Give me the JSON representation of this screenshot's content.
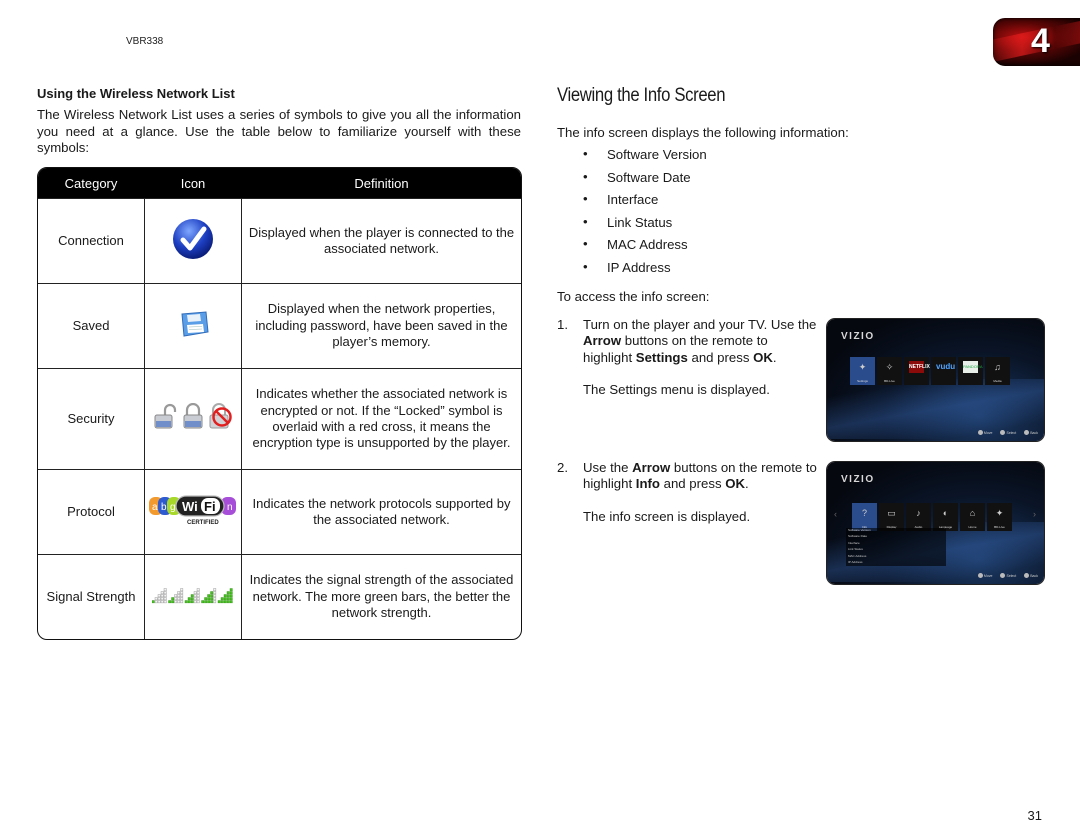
{
  "header": {
    "model": "VBR338",
    "chapter": "4"
  },
  "left": {
    "heading": "Using the Wireless Network List",
    "intro": "The Wireless Network List uses a series of symbols to give you all the information you need at a glance. Use the table below to familiarize yourself with these symbols:",
    "table": {
      "headers": [
        "Category",
        "Icon",
        "Definition"
      ],
      "rows": [
        {
          "category": "Connection",
          "icon": "checkmark-icon",
          "definition": "Displayed when the player is connected to the associated network."
        },
        {
          "category": "Saved",
          "icon": "floppy-disk-icon",
          "definition": "Displayed when the network properties, including password, have been saved in the player’s memory."
        },
        {
          "category": "Security",
          "icon": "padlock-icons",
          "definition": "Indicates whether the associated network is encrypted or not. If the “Locked” symbol is overlaid with a red cross, it means the encryption type is unsupported by the player."
        },
        {
          "category": "Protocol",
          "icon": "wifi-certified-icon",
          "definition": "Indicates the network protocols supported by the associated network."
        },
        {
          "category": "Signal Strength",
          "icon": "signal-bars-icon",
          "definition": "Indicates the signal strength of the associated network. The more green bars, the better the network strength."
        }
      ],
      "wifi_letters": [
        "a",
        "b",
        "g",
        "n"
      ],
      "wifi_text": "Wi Fi",
      "wifi_certified": "CERTIFIED",
      "signal_levels": [
        1,
        2,
        3,
        4,
        5
      ]
    }
  },
  "right": {
    "title": "Viewing the Info Screen",
    "intro": "The info screen displays the following information:",
    "bullets": [
      "Software Version",
      "Software Date",
      "Interface",
      "Link Status",
      "MAC Address",
      "IP Address"
    ],
    "access_label": "To access the info screen:",
    "steps": [
      {
        "num": "1.",
        "parts": [
          "Turn on the player and your TV. Use the ",
          "Arrow",
          " buttons on the remote to highlight ",
          "Settings",
          " and press ",
          "OK",
          "."
        ],
        "result": "The Settings menu is displayed."
      },
      {
        "num": "2.",
        "parts": [
          "Use the ",
          "Arrow",
          " buttons on the remote to highlight ",
          "Info",
          " and press ",
          "OK",
          "."
        ],
        "result": "The info screen is displayed."
      }
    ],
    "screens": [
      {
        "brand": "VIZIO",
        "tiles": [
          {
            "label": "Settings",
            "glyph": "✦",
            "sel": true
          },
          {
            "label": "BD-Live",
            "glyph": "✧"
          },
          {
            "label": "",
            "glyph": "NETFLIX",
            "kind": "netflix"
          },
          {
            "label": "",
            "glyph": "vudu",
            "kind": "vudu"
          },
          {
            "label": "",
            "glyph": "PANDORA",
            "kind": "pandora"
          },
          {
            "label": "Media",
            "glyph": "♫"
          }
        ],
        "hints": [
          "Move",
          "Select",
          "Back"
        ]
      },
      {
        "brand": "VIZIO",
        "tiles": [
          {
            "label": "Info",
            "glyph": "?",
            "sel": true
          },
          {
            "label": "Display",
            "glyph": "▭"
          },
          {
            "label": "Audio",
            "glyph": "♪"
          },
          {
            "label": "Language",
            "glyph": "◐"
          },
          {
            "label": "Home",
            "glyph": "⌂"
          },
          {
            "label": "BD-Live",
            "glyph": "✦"
          }
        ],
        "info_rows": [
          "Software Version",
          "Software Date",
          "Interface",
          "Link Status",
          "MAC Address",
          "IP Address"
        ],
        "hints": [
          "Move",
          "Select",
          "Back"
        ]
      }
    ]
  },
  "footer": {
    "page": "31"
  }
}
